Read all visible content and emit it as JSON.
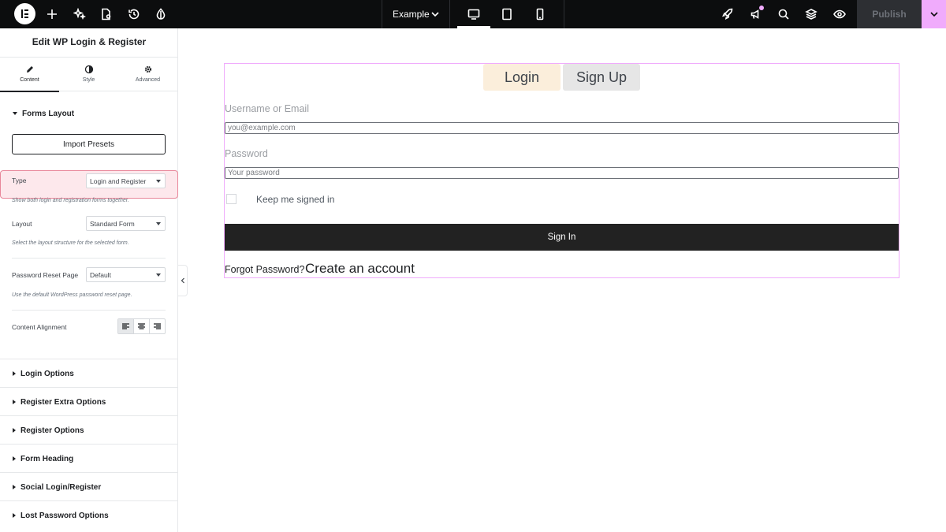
{
  "topbar": {
    "document_name": "Example",
    "publish_label": "Publish",
    "colors": {
      "background": "#0c0d0e",
      "accent": "#f0abfc"
    }
  },
  "panel": {
    "title": "Edit WP Login & Register",
    "tabs": [
      {
        "label": "Content",
        "icon": "pencil-icon",
        "active": true
      },
      {
        "label": "Style",
        "icon": "half-circle-icon",
        "active": false
      },
      {
        "label": "Advanced",
        "icon": "gear-icon",
        "active": false
      }
    ],
    "forms_layout": {
      "heading": "Forms Layout",
      "import_button": "Import Presets",
      "type": {
        "label": "Type",
        "value": "Login and Register",
        "help": "Show both login and registration forms together."
      },
      "layout": {
        "label": "Layout",
        "value": "Standard Form",
        "help": "Select the layout structure for the selected form."
      },
      "password_reset": {
        "label": "Password Reset Page",
        "value": "Default",
        "help": "Use the default WordPress password reset page."
      },
      "alignment": {
        "label": "Content Alignment",
        "options": [
          "left",
          "center",
          "right"
        ],
        "selected": "left"
      }
    },
    "sections": [
      "Login Options",
      "Register Extra Options",
      "Register Options",
      "Form Heading",
      "Social Login/Register",
      "Lost Password Options"
    ]
  },
  "form": {
    "tab_login": "Login",
    "tab_signup": "Sign Up",
    "username_label": "Username or Email",
    "username_placeholder": "you@example.com",
    "password_label": "Password",
    "password_placeholder": "Your password",
    "remember_label": "Keep me signed in",
    "remember_checked": false,
    "submit_label": "Sign In",
    "forgot_link": "Forgot Password?",
    "create_link": "Create an account"
  }
}
